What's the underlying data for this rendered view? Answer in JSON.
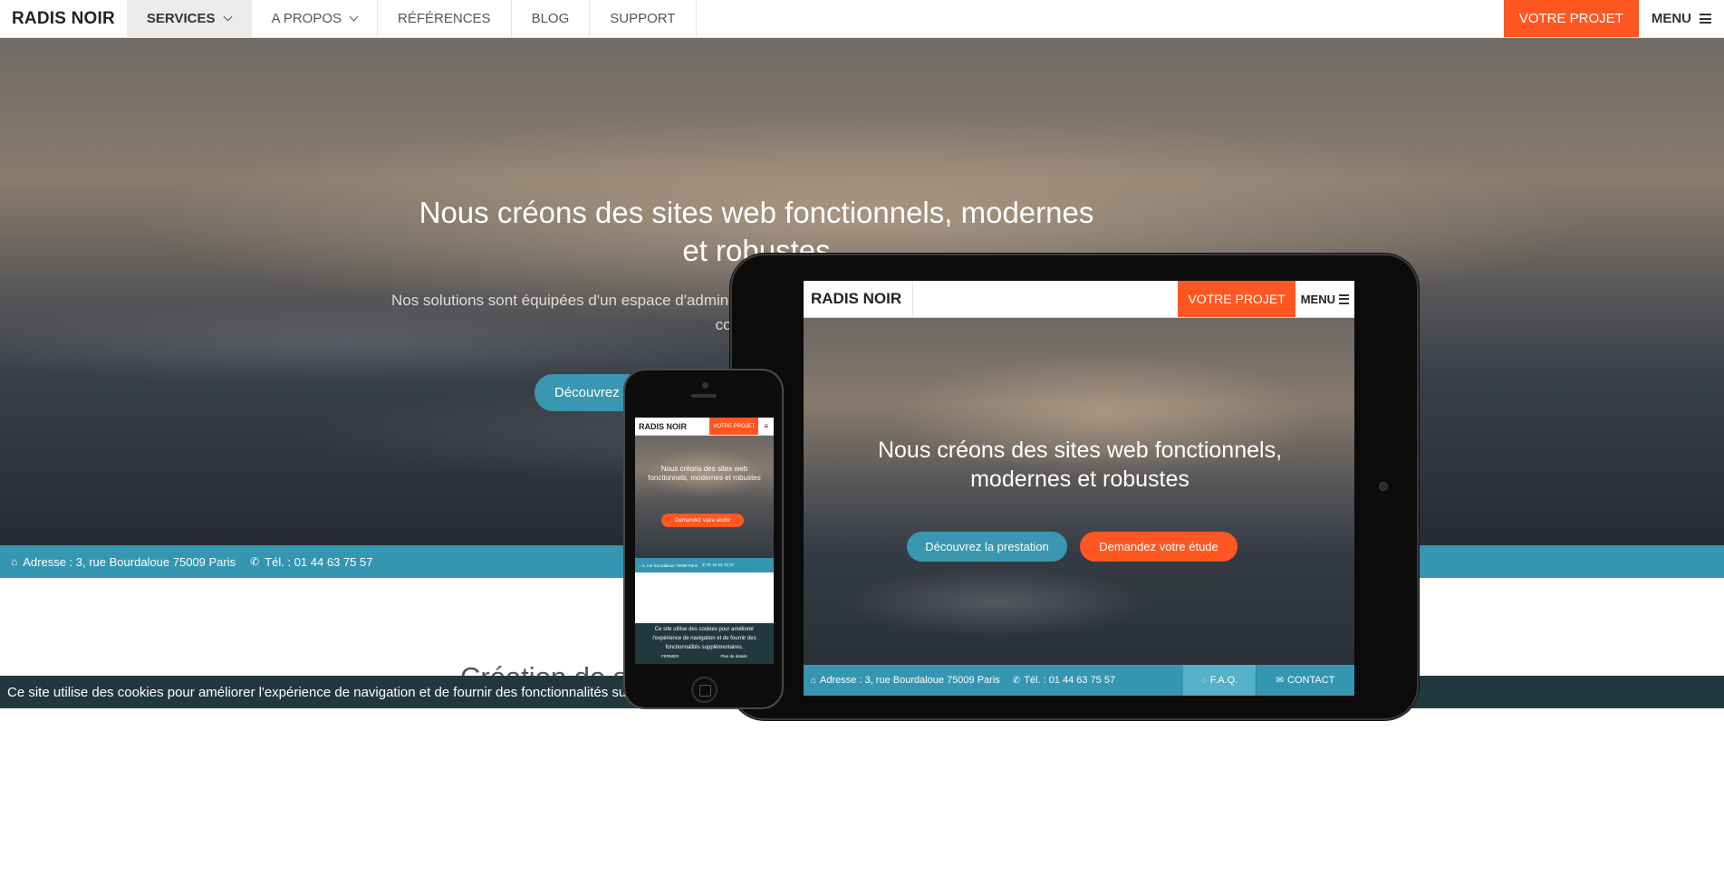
{
  "header": {
    "brand": "RADIS NOIR",
    "nav": [
      {
        "label": "SERVICES"
      },
      {
        "label": "A PROPOS"
      },
      {
        "label": "RÉFÉRENCES"
      },
      {
        "label": "BLOG"
      },
      {
        "label": "SUPPORT"
      }
    ],
    "cta_label": "VOTRE PROJET",
    "menu_label": "MENU"
  },
  "hero": {
    "title": "Nous créons des sites web fonctionnels, modernes et robustes",
    "subtitle": "Nos solutions sont équipées d'un espace d'administration, optimisées pour le référencement naturel et sont compatibles",
    "button_label": "Découvrez la prestation"
  },
  "infobar": {
    "address": "Adresse : 3, rue Bourdaloue 75009 Paris",
    "phone": "Tél. : 01 44 63 75 57"
  },
  "section": {
    "title": "Création de sites"
  },
  "cookie": {
    "text": "Ce site utilise des cookies pour améliorer l'expérience de navigation et de fournir des fonctionnalités supplémentaires."
  },
  "tablet": {
    "brand": "RADIS NOIR",
    "cta_label": "VOTRE PROJET",
    "menu_label": "MENU",
    "title": "Nous créons des sites web fonctionnels, modernes et robustes",
    "button1": "Découvrez la prestation",
    "button2": "Demandez votre étude",
    "address": "Adresse : 3, rue Bourdaloue 75009 Paris",
    "phone": "Tél. : 01 44 63 75 57",
    "faq": "F.A.Q.",
    "contact": "CONTACT"
  },
  "phone": {
    "brand": "RADIS NOIR",
    "cta_label": "VOTRE PROJET",
    "menu_glyph": "≡",
    "title": "Nous créons des sites web fonctionnels, modernes et robustes",
    "button": "Demandez votre étude",
    "address": "3, rue Bourdaloue 75009 Paris",
    "phone": "01 44 63 75 57",
    "cookie_text": "Ce site utilise des cookies pour améliorer l'expérience de navigation et de fournir des fonctionnalités supplémentaires.",
    "close_label": "FERMER",
    "more_label": "Plus de détails"
  },
  "colors": {
    "accent": "#ff5722",
    "teal": "#3596b1",
    "cookie_bg": "#22383f"
  }
}
